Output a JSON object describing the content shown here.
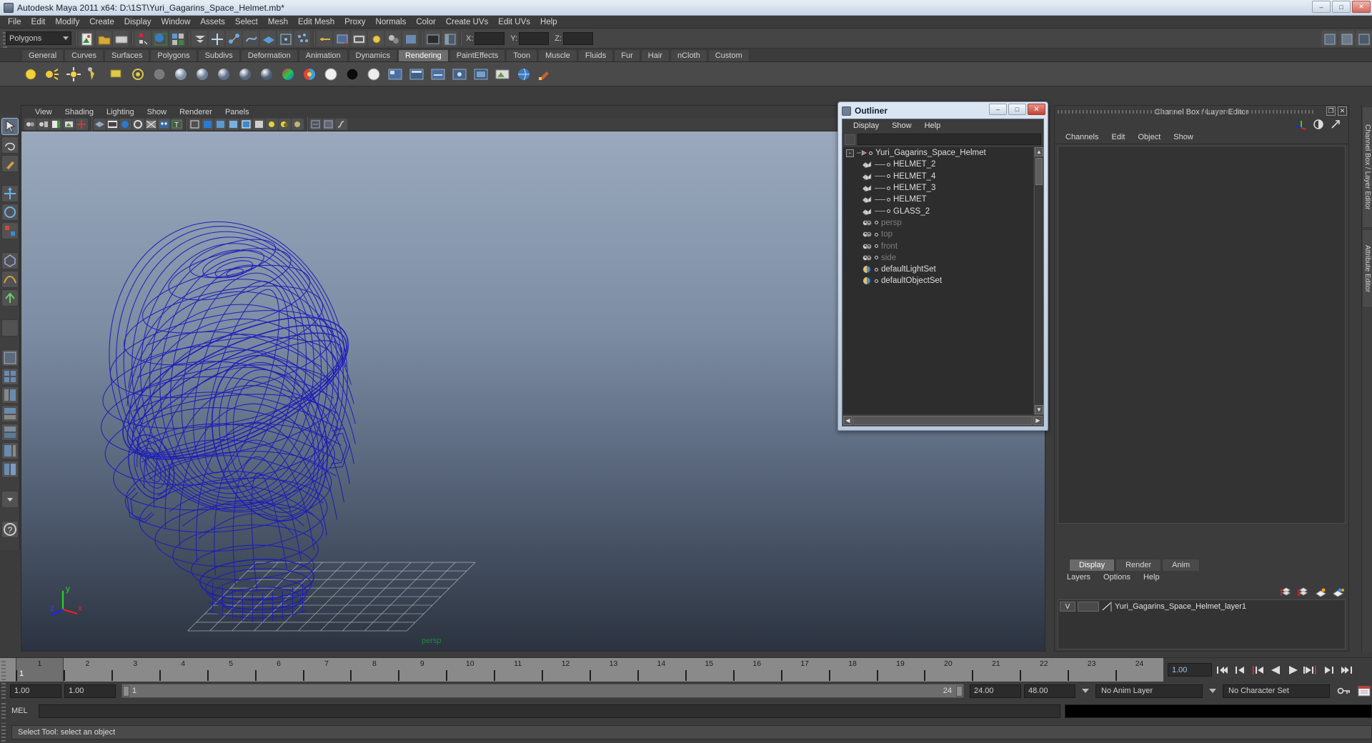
{
  "window": {
    "title": "Autodesk Maya 2011 x64: D:\\1ST\\Yuri_Gagarins_Space_Helmet.mb*",
    "icon": "maya-icon",
    "minimize": "–",
    "maximize": "□",
    "close": "✕"
  },
  "menubar": {
    "items": [
      "File",
      "Edit",
      "Modify",
      "Create",
      "Display",
      "Window",
      "Assets",
      "Select",
      "Mesh",
      "Edit Mesh",
      "Proxy",
      "Normals",
      "Color",
      "Create UVs",
      "Edit UVs",
      "Help"
    ]
  },
  "statusline": {
    "menuset": "Polygons",
    "coord_labels": [
      "X:",
      "Y:",
      "Z:"
    ],
    "coord_values": [
      "",
      "",
      ""
    ]
  },
  "shelf": {
    "tabs": [
      "General",
      "Curves",
      "Surfaces",
      "Polygons",
      "Subdivs",
      "Deformation",
      "Animation",
      "Dynamics",
      "Rendering",
      "PaintEffects",
      "Toon",
      "Muscle",
      "Fluids",
      "Fur",
      "Hair",
      "nCloth",
      "Custom"
    ],
    "active_tab": "Rendering"
  },
  "viewport": {
    "menus": [
      "View",
      "Shading",
      "Lighting",
      "Show",
      "Renderer",
      "Panels"
    ],
    "camera_label": "persp",
    "axis": {
      "x": "x",
      "y": "y",
      "z": "z"
    },
    "model_color": "#1a1ab0",
    "bg_top": "#9aa9bd",
    "bg_bottom": "#2b3340"
  },
  "outliner": {
    "title": "Outliner",
    "win_buttons": {
      "min": "–",
      "max": "□",
      "close": "✕"
    },
    "menus": [
      "Display",
      "Show",
      "Help"
    ],
    "search_value": "",
    "tree": [
      {
        "label": "Yuri_Gagarins_Space_Helmet",
        "depth": 0,
        "icon": "transform-icon",
        "expander": "-",
        "dim": false,
        "connector": false
      },
      {
        "label": "HELMET_2",
        "depth": 1,
        "icon": "mesh-icon",
        "dim": false,
        "connector": true
      },
      {
        "label": "HELMET_4",
        "depth": 1,
        "icon": "mesh-icon",
        "dim": false,
        "connector": true
      },
      {
        "label": "HELMET_3",
        "depth": 1,
        "icon": "mesh-icon",
        "dim": false,
        "connector": true
      },
      {
        "label": "HELMET",
        "depth": 1,
        "icon": "mesh-icon",
        "dim": false,
        "connector": true
      },
      {
        "label": "GLASS_2",
        "depth": 1,
        "icon": "mesh-icon",
        "dim": false,
        "connector": true
      },
      {
        "label": "persp",
        "depth": 1,
        "icon": "camera-icon",
        "dim": true,
        "connector": false
      },
      {
        "label": "top",
        "depth": 1,
        "icon": "camera-icon",
        "dim": true,
        "connector": false
      },
      {
        "label": "front",
        "depth": 1,
        "icon": "camera-icon",
        "dim": true,
        "connector": false
      },
      {
        "label": "side",
        "depth": 1,
        "icon": "camera-icon",
        "dim": true,
        "connector": false
      },
      {
        "label": "defaultLightSet",
        "depth": 1,
        "icon": "set-icon",
        "dim": false,
        "connector": false
      },
      {
        "label": "defaultObjectSet",
        "depth": 1,
        "icon": "set-icon",
        "dim": false,
        "connector": false
      }
    ]
  },
  "channelbox": {
    "title": "Channel Box / Layer Editor",
    "vertical_tabs": [
      "Channel Box / Layer Editor",
      "Attribute Editor"
    ],
    "menus": [
      "Channels",
      "Edit",
      "Object",
      "Show"
    ],
    "win_buttons": {
      "undock": "❐",
      "close": "✕"
    },
    "toolbar_icons": [
      "axis-icon",
      "half-circle-icon",
      "arrow-icon"
    ]
  },
  "layereditor": {
    "tabs": [
      "Display",
      "Render",
      "Anim"
    ],
    "active_tab": "Display",
    "menus": [
      "Layers",
      "Options",
      "Help"
    ],
    "toolbar_icons": [
      "layer-up-icon",
      "layer-down-icon",
      "new-layer-icon",
      "new-layer-selected-icon"
    ],
    "layers": [
      {
        "visibility": "V",
        "shading": "",
        "type": "",
        "name": "Yuri_Gagarins_Space_Helmet_layer1"
      }
    ]
  },
  "timeline": {
    "start": 1,
    "end": 24,
    "ticks": [
      1,
      2,
      3,
      4,
      5,
      6,
      7,
      8,
      9,
      10,
      11,
      12,
      13,
      14,
      15,
      16,
      17,
      18,
      19,
      20,
      21,
      22,
      23,
      24
    ],
    "current_frame": "1",
    "current_frame_field": "1.00",
    "playback_buttons": [
      "go-to-start-icon",
      "step-back-keyframe-icon",
      "step-back-frame-icon",
      "play-backwards-icon",
      "play-forwards-icon",
      "step-forward-frame-icon",
      "step-forward-keyframe-icon",
      "go-to-end-icon"
    ]
  },
  "rangeslider": {
    "anim_start": "1.00",
    "range_start": "1.00",
    "bar_start_label": "1",
    "bar_end_label": "24",
    "range_end": "24.00",
    "anim_end": "48.00",
    "anim_layer": "No Anim Layer",
    "character_set": "No Character Set",
    "icons": [
      "key-icon",
      "autokey-icon"
    ]
  },
  "mel": {
    "label": "MEL",
    "input_value": "",
    "output_value": ""
  },
  "status": {
    "message": "Select Tool: select an object"
  }
}
